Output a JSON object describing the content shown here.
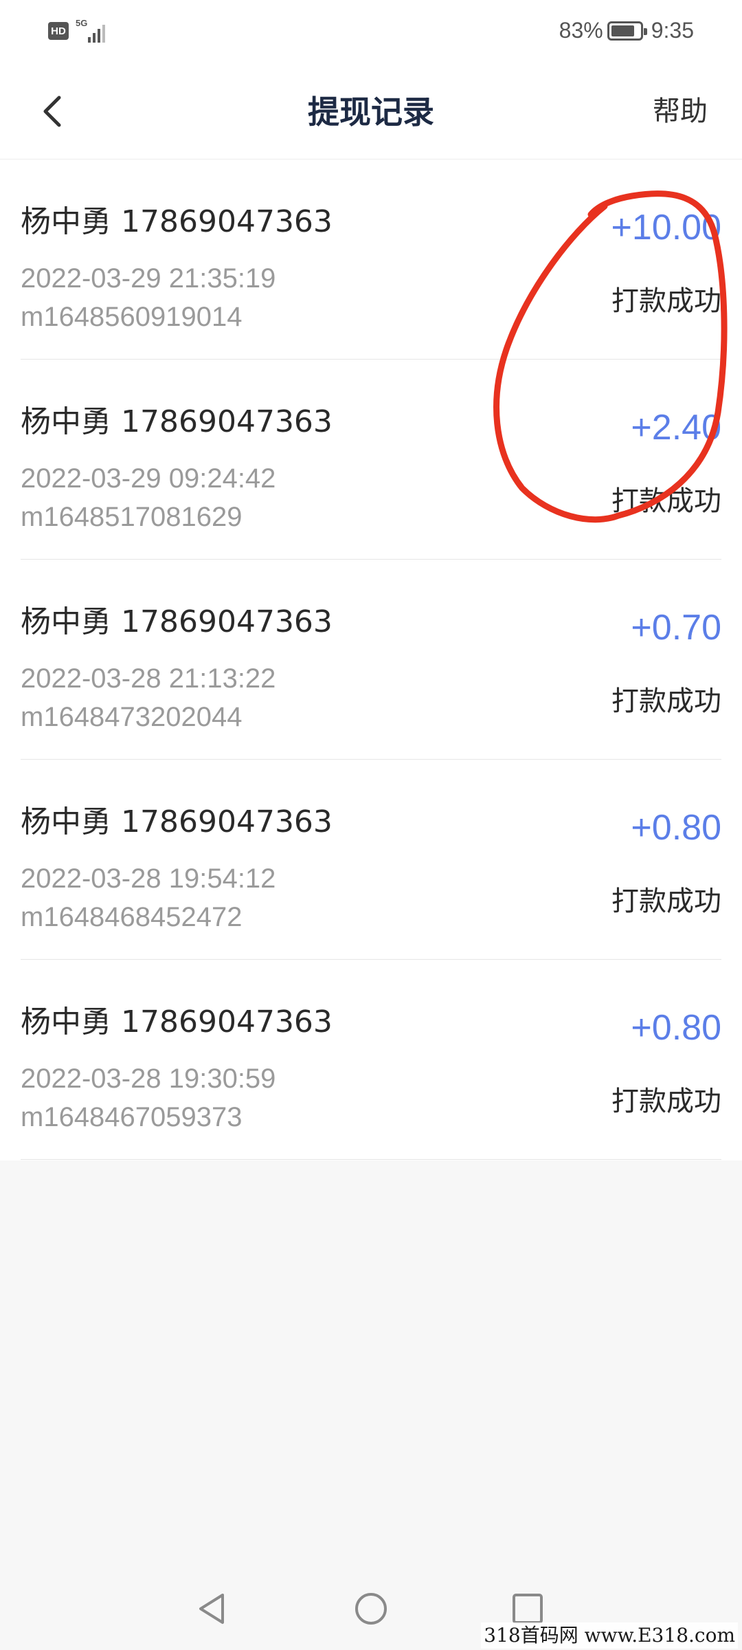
{
  "status_bar": {
    "hd_label": "HD",
    "network_label": "5G",
    "battery_percent": "83%",
    "battery_level": 0.83,
    "time": "9:35"
  },
  "header": {
    "back_icon": "chevron-left-icon",
    "title": "提现记录",
    "help_label": "帮助"
  },
  "records": [
    {
      "name_phone": "杨中勇 17869047363",
      "time": "2022-03-29 21:35:19",
      "order_id": "m1648560919014",
      "amount": "+10.00",
      "status": "打款成功"
    },
    {
      "name_phone": "杨中勇 17869047363",
      "time": "2022-03-29 09:24:42",
      "order_id": "m1648517081629",
      "amount": "+2.40",
      "status": "打款成功"
    },
    {
      "name_phone": "杨中勇 17869047363",
      "time": "2022-03-28 21:13:22",
      "order_id": "m1648473202044",
      "amount": "+0.70",
      "status": "打款成功"
    },
    {
      "name_phone": "杨中勇 17869047363",
      "time": "2022-03-28 19:54:12",
      "order_id": "m1648468452472",
      "amount": "+0.80",
      "status": "打款成功"
    },
    {
      "name_phone": "杨中勇 17869047363",
      "time": "2022-03-28 19:30:59",
      "order_id": "m1648467059373",
      "amount": "+0.80",
      "status": "打款成功"
    }
  ],
  "colors": {
    "amount": "#5b7ee8",
    "annotation": "#e8321f",
    "title": "#1d2a44"
  },
  "nav": {
    "back_icon": "triangle-back-icon",
    "home_icon": "circle-home-icon",
    "recents_icon": "square-recents-icon"
  },
  "watermark": "318首码网 www.E318.com"
}
